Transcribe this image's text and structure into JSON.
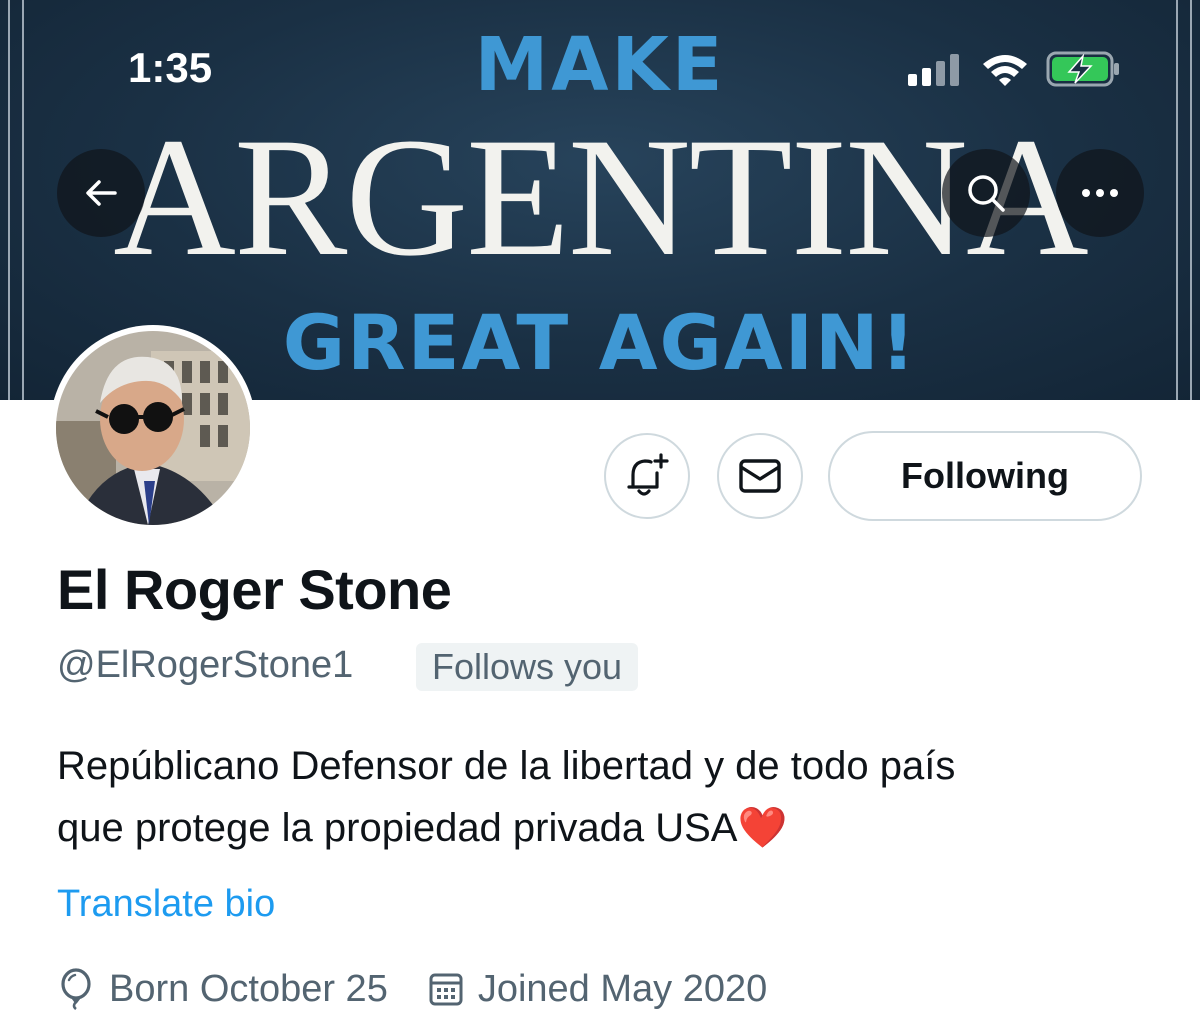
{
  "status_bar": {
    "time": "1:35"
  },
  "banner": {
    "line1": "MAKE",
    "line2": "ARGENTINA",
    "line3": "GREAT AGAIN!",
    "accent_color": "#3f98d4",
    "background_color": "#1a3044"
  },
  "nav": {
    "back_icon": "arrow-left-icon",
    "search_icon": "search-icon",
    "more_icon": "more-horizontal-icon"
  },
  "actions": {
    "notify_icon": "bell-plus-icon",
    "message_icon": "envelope-icon",
    "following_label": "Following"
  },
  "profile": {
    "display_name": "El Roger Stone",
    "handle": "@ElRogerStone1",
    "follows_you": "Follows you",
    "bio_line1": "Repúblicano Defensor de la libertad y de todo país",
    "bio_line2": "que protege la propiedad privada USA",
    "bio_emoji": "❤️",
    "translate_label": "Translate bio",
    "birthday_icon": "balloon-icon",
    "birthday": "Born October 25",
    "joined_icon": "calendar-icon",
    "joined": "Joined May 2020",
    "link_color": "#1d9bf0"
  }
}
